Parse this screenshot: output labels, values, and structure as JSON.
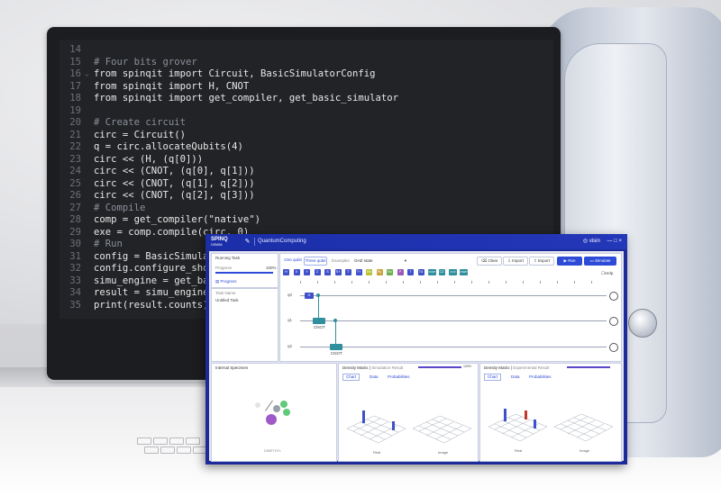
{
  "code_editor": {
    "lines": [
      {
        "n": "14",
        "text": ""
      },
      {
        "n": "15",
        "text": "# Four bits grover",
        "comment": true
      },
      {
        "n": "16",
        "text": "from spinqit import Circuit, BasicSimulatorConfig",
        "fold": true
      },
      {
        "n": "17",
        "text": "from spinqit import H, CNOT"
      },
      {
        "n": "18",
        "text": "from spinqit import get_compiler, get_basic_simulator"
      },
      {
        "n": "19",
        "text": ""
      },
      {
        "n": "20",
        "text": "# Create circuit",
        "comment": true
      },
      {
        "n": "21",
        "text": "circ = Circuit()"
      },
      {
        "n": "22",
        "text": "q = circ.allocateQubits(4)"
      },
      {
        "n": "23",
        "text": "circ << (H, (q[0]))"
      },
      {
        "n": "24",
        "text": "circ << (CNOT, (q[0], q[1]))"
      },
      {
        "n": "25",
        "text": "circ << (CNOT, (q[1], q[2]))"
      },
      {
        "n": "26",
        "text": "circ << (CNOT, (q[2], q[3]))"
      },
      {
        "n": "27",
        "text": "# Compile",
        "comment": true
      },
      {
        "n": "28",
        "text": "comp = get_compiler(\"native\")"
      },
      {
        "n": "29",
        "text": "exe = comp.compile(circ, 0)"
      },
      {
        "n": "30",
        "text": "# Run",
        "comment": true
      },
      {
        "n": "31",
        "text": "config = BasicSimulator"
      },
      {
        "n": "32",
        "text": "config.configure_shots"
      },
      {
        "n": "33",
        "text": "simu_engine = get_basic"
      },
      {
        "n": "34",
        "text": "result = simu_engine.ex"
      },
      {
        "n": "35",
        "text": "print(result.counts) #"
      }
    ]
  },
  "app": {
    "logo": "SPINQ",
    "logo_sub": "GEMINI",
    "title": "QuantumComputing",
    "user": "visin",
    "window_controls": "— □ ×",
    "sidebar": {
      "running_task": "Running Task",
      "progress_label": "Progress",
      "progress_value": "100%",
      "progress_fraction": 1.0,
      "progress_link": "Progress",
      "task_name_label": "Task Name",
      "task_name_value": "Untitled Task"
    },
    "toolbar": {
      "mode_one": "One qubit",
      "mode_three": "Three qubit",
      "examples_label": "Examples",
      "examples_value": "GHZ state",
      "clear": "Clear",
      "import": "Import",
      "export": "Export",
      "run": "Run",
      "simulate": "Simulate",
      "help": "Help"
    },
    "gates": [
      {
        "label": "H",
        "color": "#3f51c9"
      },
      {
        "label": "X",
        "color": "#3f51c9"
      },
      {
        "label": "Y",
        "color": "#3f51c9"
      },
      {
        "label": "Z",
        "color": "#3f51c9"
      },
      {
        "label": "S",
        "color": "#3f51c9"
      },
      {
        "label": "S†",
        "color": "#3f51c9"
      },
      {
        "label": "T",
        "color": "#3f51c9"
      },
      {
        "label": "T†",
        "color": "#3f51c9"
      },
      {
        "label": "Rx",
        "color": "#b7c43a"
      },
      {
        "label": "Ry",
        "color": "#c9a23a"
      },
      {
        "label": "Rz",
        "color": "#6ab04c"
      },
      {
        "label": "P",
        "color": "#9b59b6"
      },
      {
        "label": "T",
        "color": "#3f51c9"
      },
      {
        "label": "Td",
        "color": "#3f51c9"
      },
      {
        "label": "CNOT",
        "color": "#2f8f9d"
      },
      {
        "label": "CZ",
        "color": "#2f8f9d"
      },
      {
        "label": "CCX",
        "color": "#2f8f9d"
      },
      {
        "label": "CSWP",
        "color": "#2f8f9d"
      }
    ],
    "circuit": {
      "qubits": [
        "q0",
        "q1",
        "q2"
      ],
      "h_gate": "H",
      "cnot_1": "CNOT",
      "cnot_2": "CNOT"
    },
    "panels": {
      "specimen_title": "Internal Specimen",
      "specimen_caption": "DIMETHYL",
      "sim_title": "Density Matrix",
      "sim_subtitle": "Simulation Result",
      "exp_title": "Density Matrix",
      "exp_subtitle": "Experimental Result",
      "tab_chart": "Chart",
      "tab_data": "Data",
      "tab_probabilities": "Probabilities",
      "real_label": "Real",
      "imag_label": "Image",
      "panel_progress": "100%"
    }
  }
}
